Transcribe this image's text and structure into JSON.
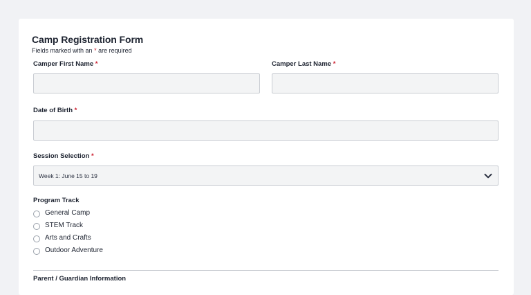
{
  "form": {
    "title": "Camp Registration Form",
    "subtitle_before": "Fields marked with an",
    "subtitle_star": "*",
    "subtitle_after": "are required",
    "required_marker": "*"
  },
  "fields": {
    "first_name": {
      "label": "Camper First Name",
      "value": ""
    },
    "last_name": {
      "label": "Camper Last Name",
      "value": ""
    },
    "dob": {
      "label": "Date of Birth",
      "value": ""
    },
    "session": {
      "label": "Session Selection",
      "selected": "Week 1: June 15 to 19"
    }
  },
  "program_track": {
    "label": "Program Track",
    "options": [
      "General Camp",
      "STEM Track",
      "Arts and Crafts",
      "Outdoor Adventure"
    ]
  },
  "section": {
    "parent_heading": "Parent / Guardian Information"
  },
  "icons": {
    "session_dropdown": "chevron-down-icon"
  },
  "colors": {
    "required": "#cc1f2f",
    "background": "#f1f2f5",
    "input_fill": "#f3f4f5"
  }
}
